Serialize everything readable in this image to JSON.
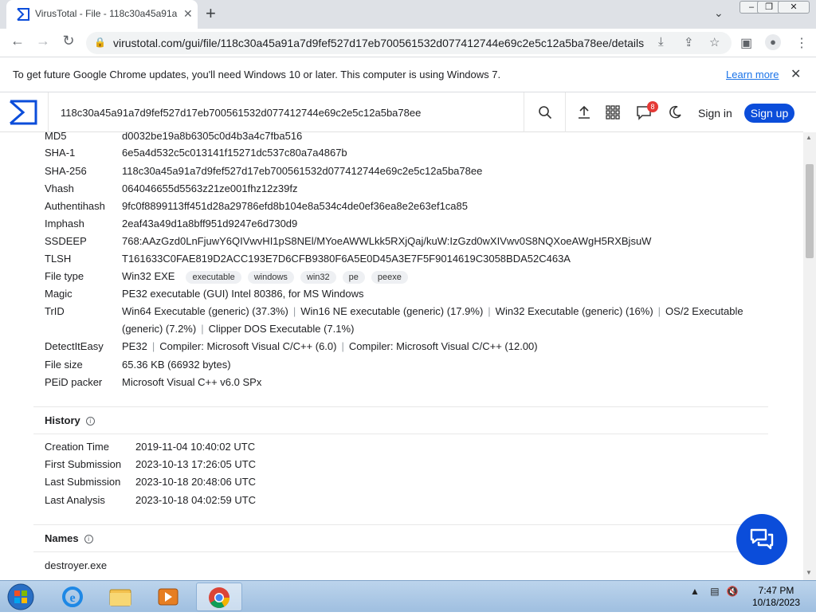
{
  "browser": {
    "tab_title": "VirusTotal - File - 118c30a45a91a",
    "tab_close": "✕",
    "new_tab": "+",
    "url": "virustotal.com/gui/file/118c30a45a91a7d9fef527d17eb700561532d077412744e69c2e5c12a5ba78ee/details"
  },
  "infobar": {
    "message": "To get future Google Chrome updates, you'll need Windows 10 or later. This computer is using Windows 7.",
    "link": "Learn more"
  },
  "vt_header": {
    "search_value": "118c30a45a91a7d9fef527d17eb700561532d077412744e69c2e5c12a5ba78ee",
    "notification_count": "8",
    "sign_in": "Sign in",
    "sign_up": "Sign up"
  },
  "details": {
    "md5": {
      "label": "MD5",
      "value": "d0032be19a8b6305c0d4b3a4c7fba516"
    },
    "sha1": {
      "label": "SHA-1",
      "value": "6e5a4d532c5c013141f15271dc537c80a7a4867b"
    },
    "sha256": {
      "label": "SHA-256",
      "value": "118c30a45a91a7d9fef527d17eb700561532d077412744e69c2e5c12a5ba78ee"
    },
    "vhash": {
      "label": "Vhash",
      "value": "064046655d5563z21ze001fhz12z39fz"
    },
    "authentihash": {
      "label": "Authentihash",
      "value": "9fc0f8899113ff451d28a29786efd8b104e8a534c4de0ef36ea8e2e63ef1ca85"
    },
    "imphash": {
      "label": "Imphash",
      "value": "2eaf43a49d1a8bff951d9247e6d730d9"
    },
    "ssdeep": {
      "label": "SSDEEP",
      "value": "768:AAzGzd0LnFjuwY6QIVwvHI1pS8NEl/MYoeAWWLkk5RXjQaj/kuW:IzGzd0wXIVwv0S8NQXoeAWgH5RXBjsuW"
    },
    "tlsh": {
      "label": "TLSH",
      "value": "T161633C0FAE819D2ACC193E7D6CFB9380F6A5E0D45A3E7F5F9014619C3058BDA52C463A"
    },
    "file_type": {
      "label": "File type",
      "value": "Win32 EXE",
      "tags": [
        "executable",
        "windows",
        "win32",
        "pe",
        "peexe"
      ]
    },
    "magic": {
      "label": "Magic",
      "value": "PE32 executable (GUI) Intel 80386, for MS Windows"
    },
    "trid": {
      "label": "TrID",
      "line1": [
        "Win64 Executable (generic) (37.3%)",
        "Win16 NE executable (generic) (17.9%)",
        "Win32 Executable (generic) (16%)",
        "OS/2 Executable"
      ],
      "line2": [
        "(generic) (7.2%)",
        "Clipper DOS Executable (7.1%)"
      ]
    },
    "detect_it_easy": {
      "label": "DetectItEasy",
      "values": [
        "PE32",
        "Compiler: Microsoft Visual C/C++ (6.0)",
        "Compiler: Microsoft Visual C/C++ (12.00)"
      ]
    },
    "file_size": {
      "label": "File size",
      "value": "65.36 KB (66932 bytes)"
    },
    "peid": {
      "label": "PEiD packer",
      "value": "Microsoft Visual C++ v6.0 SPx"
    }
  },
  "history": {
    "title": "History",
    "rows": [
      {
        "label": "Creation Time",
        "value": "2019-11-04 10:40:02 UTC"
      },
      {
        "label": "First Submission",
        "value": "2023-10-13 17:26:05 UTC"
      },
      {
        "label": "Last Submission",
        "value": "2023-10-18 20:48:06 UTC"
      },
      {
        "label": "Last Analysis",
        "value": "2023-10-18 04:02:59 UTC"
      }
    ]
  },
  "names": {
    "title": "Names",
    "items": [
      "destroyer.exe"
    ]
  },
  "taskbar": {
    "time": "7:47 PM",
    "date": "10/18/2023"
  },
  "colors": {
    "brand_blue": "#0b4dda",
    "badge_red": "#e53935",
    "link_blue": "#1a73e8"
  }
}
